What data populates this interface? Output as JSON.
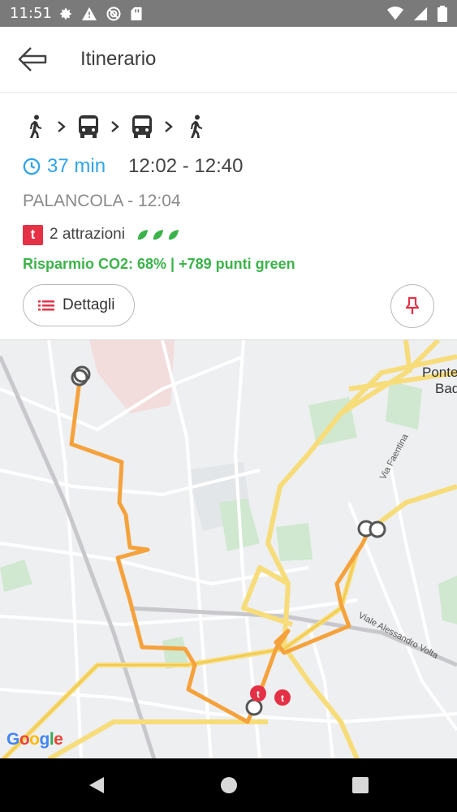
{
  "status_bar": {
    "time": "11:51",
    "left_icons": [
      "gear-icon",
      "warning-icon",
      "no-data-icon",
      "sd-card-icon"
    ],
    "right_icons": [
      "wifi-icon",
      "signal-icon",
      "battery-icon"
    ]
  },
  "app_bar": {
    "title": "Itinerario"
  },
  "trip": {
    "modes": [
      "walk-icon",
      "bus-icon",
      "bus-icon",
      "walk-icon"
    ],
    "duration": "37 min",
    "time_range": "12:02 - 12:40",
    "stop": "PALANCOLA - 12:04",
    "attractions_badge": "t",
    "attractions": "2 attrazioni",
    "leaf_count": 3,
    "co2": "Risparmio CO2: 68% | +789 punti green",
    "details_label": "Dettagli"
  },
  "map": {
    "labels": {
      "ponte": "Ponte",
      "bad": "Bad",
      "faentina": "Via Faentina",
      "volta": "Viale Alessandro Volta"
    },
    "google": [
      "G",
      "o",
      "o",
      "g",
      "l",
      "e"
    ],
    "poi_badge": "t"
  },
  "colors": {
    "accent_blue": "#2fa4e7",
    "green": "#3cb34a",
    "red": "#e53145",
    "route_orange": "#f5a23c",
    "status_gray": "#7a7a7a"
  }
}
